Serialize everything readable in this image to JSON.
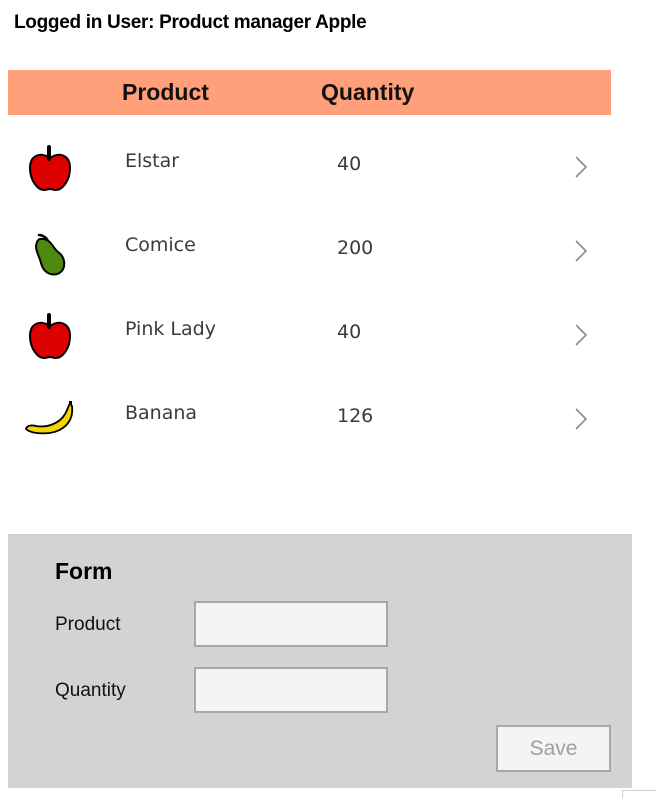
{
  "login": {
    "text": "Logged in User: Product manager Apple"
  },
  "gallery": {
    "header": {
      "product": "Product",
      "quantity": "Quantity"
    },
    "rows": [
      {
        "icon": "apple-icon",
        "name": "Elstar",
        "quantity": "40"
      },
      {
        "icon": "pear-icon",
        "name": "Comice",
        "quantity": "200"
      },
      {
        "icon": "apple-icon",
        "name": "Pink Lady",
        "quantity": "40"
      },
      {
        "icon": "banana-icon",
        "name": "Banana",
        "quantity": "126"
      }
    ]
  },
  "form": {
    "title": "Form",
    "product_label": "Product",
    "quantity_label": "Quantity",
    "product_value": "",
    "quantity_value": "",
    "save_label": "Save"
  },
  "colors": {
    "header_bg": "#FFA07A",
    "form_bg": "#D3D3D3",
    "apple": "#DD0000",
    "pear": "#4E8A0E",
    "banana": "#F5D400"
  }
}
